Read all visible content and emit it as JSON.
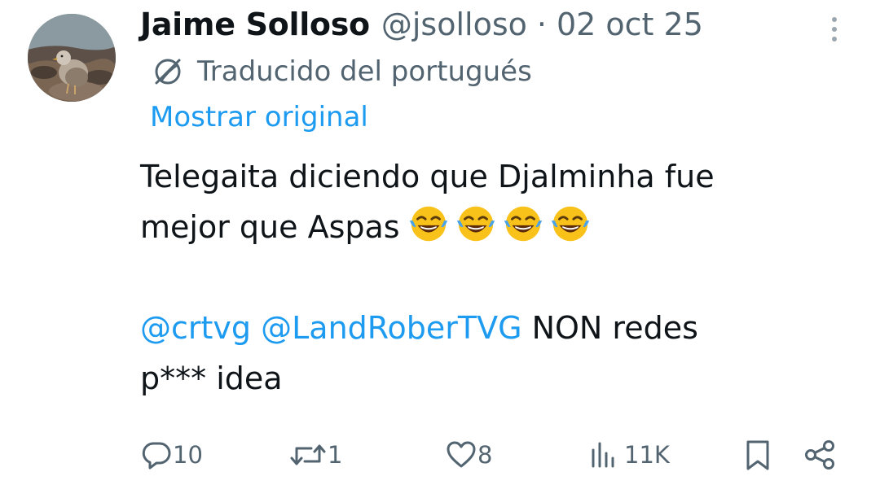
{
  "tweet": {
    "author": {
      "display_name": "Jaime Solloso",
      "handle": "@jsolloso",
      "separator": "·",
      "date": "02 oct 25"
    },
    "translation_notice": "Traducido del portugués",
    "show_original_label": "Mostrar original",
    "body": {
      "line1": "Telegaita diciendo que Djalminha fue",
      "line2_text": "mejor que Aspas",
      "emoji_count": 4,
      "mention1": "@crtvg",
      "mention2": "@LandRoberTVG",
      "line3_rest": " NON redes",
      "line4": "p*** idea"
    },
    "actions": {
      "replies": "10",
      "reposts": "1",
      "likes": "8",
      "views": "11K"
    },
    "icons": [
      "more-vertical-icon",
      "translate-icon",
      "laughing-tears-emoji",
      "reply-icon",
      "repost-icon",
      "like-icon",
      "views-icon",
      "bookmark-icon",
      "share-icon"
    ],
    "colors": {
      "text": "#0f1419",
      "secondary": "#536471",
      "link": "#1d9bf0"
    }
  }
}
